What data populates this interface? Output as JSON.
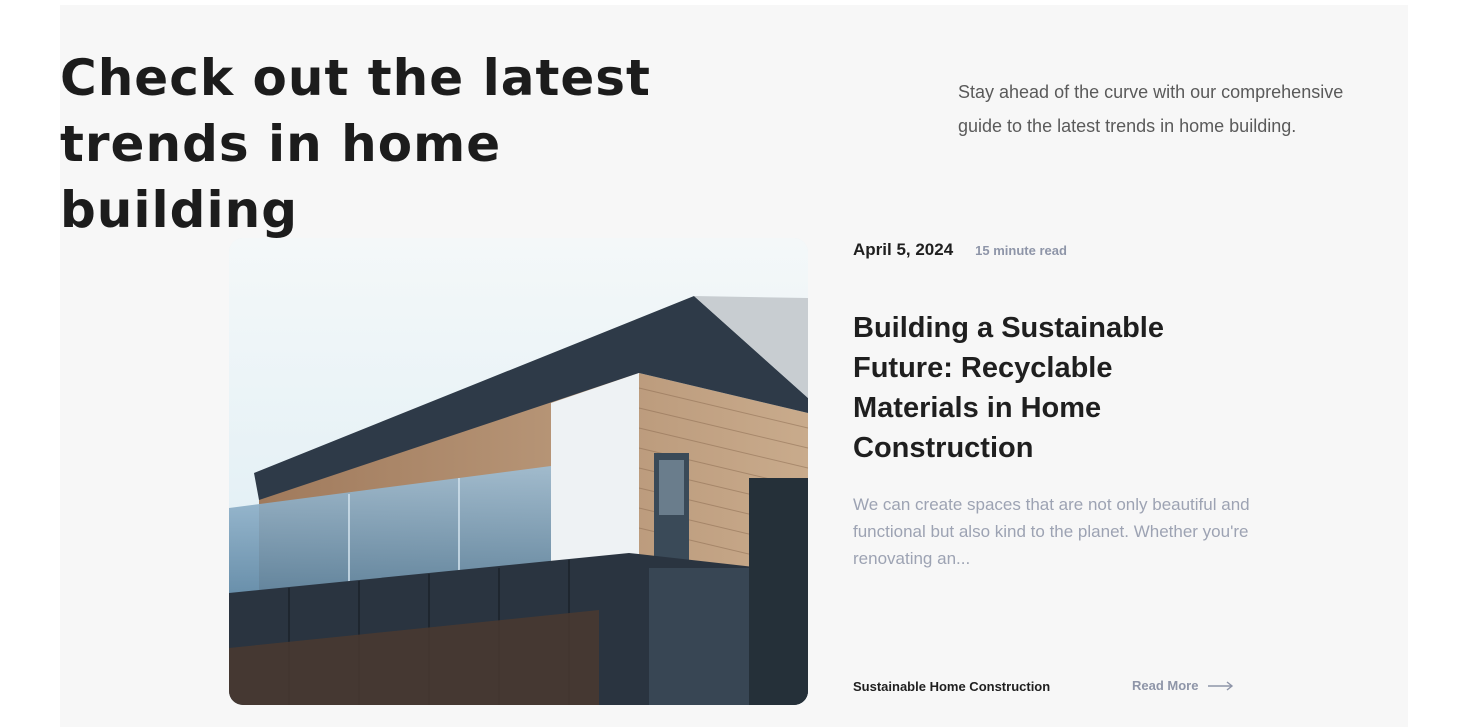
{
  "header": {
    "title": "Check out the latest trends in home building",
    "intro": "Stay ahead of the curve with our comprehensive guide to the latest trends in home building."
  },
  "post": {
    "date": "April 5, 2024",
    "read_time": "15 minute read",
    "title": "Building a Sustainable Future: Recyclable Materials in Home Construction",
    "excerpt": "We can create spaces that are not only beautiful and functional but also kind to the planet. Whether you're renovating an...",
    "category": "Sustainable Home Construction",
    "read_more_label": "Read More",
    "read_more_icon": "arrow-right-icon",
    "image_alt": "house-photo"
  },
  "colors": {
    "section_bg": "#f7f7f7",
    "heading": "#1c1c1c",
    "muted": "#9da3b3",
    "meta": "#8e95a8"
  }
}
